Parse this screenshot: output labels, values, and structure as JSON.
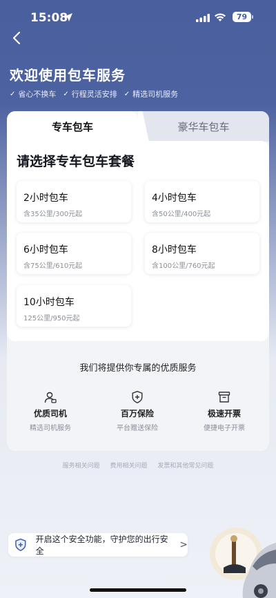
{
  "status_bar": {
    "time": "15:08",
    "battery": "79"
  },
  "header": {
    "title": "欢迎使用包车服务",
    "features": [
      "省心不换车",
      "行程灵活安排",
      "精选司机服务"
    ]
  },
  "tabs": [
    {
      "label": "专车包车",
      "active": true
    },
    {
      "label": "豪华车包车",
      "active": false
    }
  ],
  "panel": {
    "title": "请选择专车包车套餐",
    "packages": [
      {
        "name": "2小时包车",
        "desc": "含35公里/300元起"
      },
      {
        "name": "4小时包车",
        "desc": "含50公里/400元起"
      },
      {
        "name": "6小时包车",
        "desc": "含75公里/610元起"
      },
      {
        "name": "8小时包车",
        "desc": "含100公里/760元起"
      },
      {
        "name": "10小时包车",
        "desc": "125公里/950元起"
      }
    ]
  },
  "services": {
    "title": "我们将提供你专属的优质服务",
    "items": [
      {
        "name": "优质司机",
        "desc": "精选司机服务",
        "icon": "driver-icon"
      },
      {
        "name": "百万保险",
        "desc": "平台赠送保险",
        "icon": "shield-plus-icon"
      },
      {
        "name": "极速开票",
        "desc": "便捷电子开票",
        "icon": "invoice-icon"
      }
    ]
  },
  "faq_links": [
    "服务相关问题",
    "费用相关问题",
    "发票和其他常见问题"
  ],
  "safety_banner": {
    "text": "开启这个安全功能，守护您的出行安全",
    "chevron": ">"
  },
  "colors": {
    "header_bg": "#4a5f9d",
    "accent": "#3f5ea8"
  }
}
